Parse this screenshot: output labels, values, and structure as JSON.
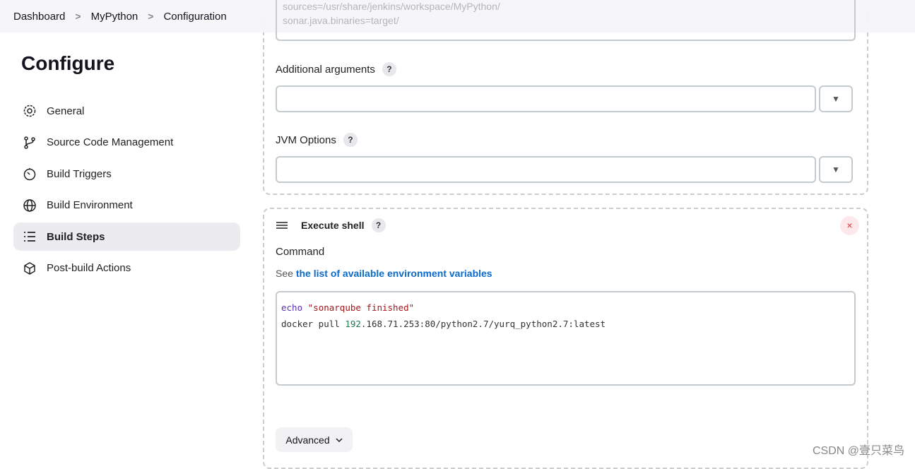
{
  "breadcrumb": [
    "Dashboard",
    "MyPython",
    "Configuration"
  ],
  "page_title": "Configure",
  "sidebar": {
    "items": [
      {
        "label": "General",
        "icon": "gear-icon"
      },
      {
        "label": "Source Code Management",
        "icon": "branch-icon"
      },
      {
        "label": "Build Triggers",
        "icon": "timer-icon"
      },
      {
        "label": "Build Environment",
        "icon": "globe-icon"
      },
      {
        "label": "Build Steps",
        "icon": "list-icon",
        "active": true
      },
      {
        "label": "Post-build Actions",
        "icon": "box-icon"
      }
    ]
  },
  "previous_step": {
    "properties_text": [
      "sources=/usr/share/jenkins/workspace/MyPython/",
      "sonar.java.binaries=target/"
    ],
    "additional_arguments_label": "Additional arguments",
    "additional_arguments_value": "",
    "jvm_options_label": "JVM Options",
    "jvm_options_value": ""
  },
  "help_label": "?",
  "dropdown_glyph": "▼",
  "execute_shell": {
    "title": "Execute shell",
    "close": "×",
    "command_label": "Command",
    "see_text": "See",
    "env_link": "the list of available environment variables",
    "command_lines": {
      "l1_kw": "echo",
      "l1_str": "\"sonarqube finished\"",
      "l2_a": "docker pull ",
      "l2_num": "192",
      "l2_b": ".168.71.253:80/python2.7/yurq_python2.7:latest"
    },
    "advanced_label": "Advanced"
  },
  "watermark": "CSDN @壹只菜鸟"
}
